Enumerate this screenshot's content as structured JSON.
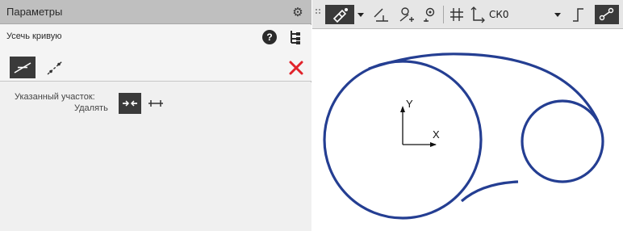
{
  "panel": {
    "title": "Параметры",
    "command": "Усечь кривую",
    "segment_label": "Указанный участок:",
    "delete_label": "Удалять"
  },
  "icons": {
    "gear": "gear-icon",
    "help": "question-mark-icon",
    "tree": "tree-structure-icon",
    "trim_mode": "trim-line-icon",
    "trim_points_mode": "trim-points-icon",
    "cancel": "close-icon",
    "delete_segment": "delete-segment-icon",
    "keep_segment": "keep-segment-icon"
  },
  "toolbar": {
    "cs_label": "СК0",
    "icons": [
      "grip-handle-icon",
      "magnet-snap-icon",
      "dropdown-arrow-icon",
      "orthogonal-icon",
      "local-snap-icon",
      "trace-icon",
      "grid-icon",
      "coordinate-system-icon",
      "dropdown-arrow-icon",
      "angle-icon",
      "parametric-icon"
    ]
  },
  "canvas": {
    "axis_y": "Y",
    "axis_x": "X"
  },
  "colors": {
    "curve": "#243e92",
    "cancel": "#e1232b",
    "panel_header": "#bfbfbf",
    "active_button": "#3a3a3a"
  }
}
